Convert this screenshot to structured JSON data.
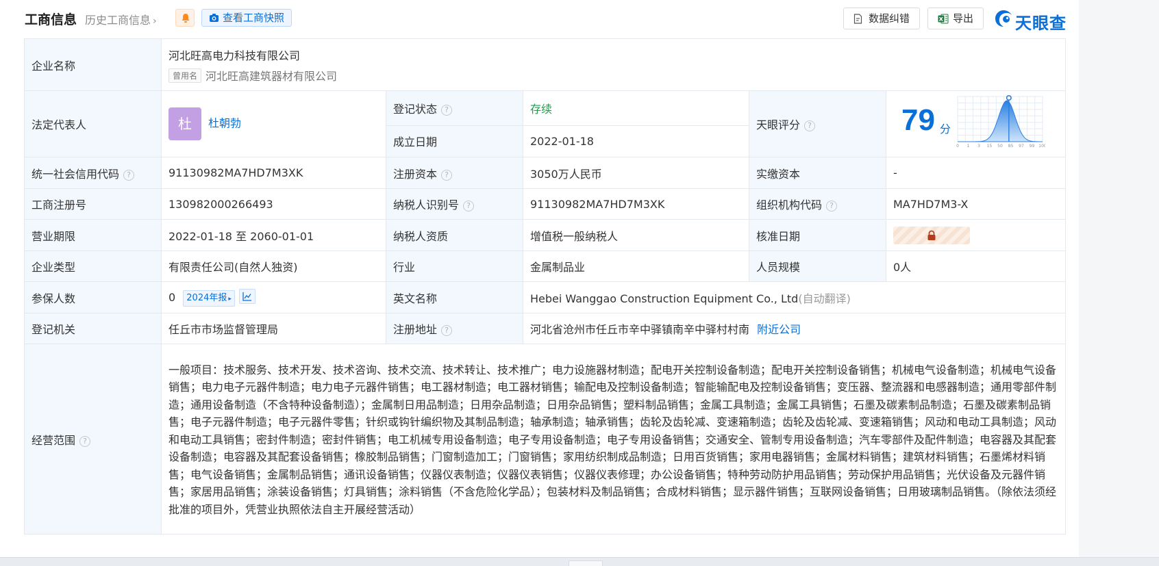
{
  "header": {
    "title": "工商信息",
    "history_link": "历史工商信息",
    "snapshot_button": "查看工商快照",
    "correct_button": "数据纠错",
    "export_button": "导出",
    "logo_text": "天眼查",
    "colors": {
      "accent": "#0a6fd6",
      "bell": "#ff8a1f",
      "excel": "#1f7a3f"
    }
  },
  "company": {
    "name_label": "企业名称",
    "name": "河北旺高电力科技有限公司",
    "used_name_tag": "曾用名",
    "used_name": "河北旺高建筑器材有限公司",
    "legal_rep_label": "法定代表人",
    "legal_rep_avatar": "杜",
    "legal_rep": "杜朝勃",
    "reg_status_label": "登记状态",
    "reg_status": "存续",
    "founded_label": "成立日期",
    "founded": "2022-01-18",
    "score_label": "天眼评分",
    "score": "79",
    "score_unit": "分",
    "credit_code_label": "统一社会信用代码",
    "credit_code": "91130982MA7HD7M3XK",
    "reg_capital_label": "注册资本",
    "reg_capital": "3050万人民币",
    "paid_capital_label": "实缴资本",
    "paid_capital": "-",
    "biz_reg_no_label": "工商注册号",
    "biz_reg_no": "130982000266493",
    "taxpayer_id_label": "纳税人识别号",
    "taxpayer_id": "91130982MA7HD7M3XK",
    "org_code_label": "组织机构代码",
    "org_code": "MA7HD7M3-X",
    "term_label": "营业期限",
    "term": "2022-01-18 至 2060-01-01",
    "taxpayer_qual_label": "纳税人资质",
    "taxpayer_qual": "增值税一般纳税人",
    "approve_date_label": "核准日期",
    "type_label": "企业类型",
    "type": "有限责任公司(自然人独资)",
    "industry_label": "行业",
    "industry": "金属制品业",
    "staff_label": "人员规模",
    "staff": "0人",
    "insured_label": "参保人数",
    "insured": "0",
    "insured_report": "2024年报",
    "en_name_label": "英文名称",
    "en_name": "Hebei Wanggao Construction Equipment Co., Ltd",
    "en_name_note": "(自动翻译)",
    "authority_label": "登记机关",
    "authority": "任丘市市场监督管理局",
    "address_label": "注册地址",
    "address": "河北省沧州市任丘市辛中驿镇南辛中驿村村南",
    "nearby_link": "附近公司",
    "scope_label": "经营范围",
    "scope": "一般项目：技术服务、技术开发、技术咨询、技术交流、技术转让、技术推广；电力设施器材制造；配电开关控制设备制造；配电开关控制设备销售；机械电气设备制造；机械电气设备销售；电力电子元器件制造；电力电子元器件销售；电工器材制造；电工器材销售；输配电及控制设备制造；智能输配电及控制设备销售；变压器、整流器和电感器制造；通用零部件制造；通用设备制造（不含特种设备制造）；金属制日用品制造；日用杂品制造；日用杂品销售；塑料制品销售；金属工具制造；金属工具销售；石墨及碳素制品制造；石墨及碳素制品销售；电子元器件制造；电子元器件零售；针织或钩针编织物及其制品制造；轴承制造；轴承销售；齿轮及齿轮减、变速箱制造；齿轮及齿轮减、变速箱销售；风动和电动工具制造；风动和电动工具销售；密封件制造；密封件销售；电工机械专用设备制造；电子专用设备制造；电子专用设备销售；交通安全、管制专用设备制造；汽车零部件及配件制造；电容器及其配套设备制造；电容器及其配套设备销售；橡胶制品销售；门窗制造加工；门窗销售；家用纺织制成品制造；日用百货销售；家用电器销售；金属材料销售；建筑材料销售；石墨烯材料销售；电气设备销售；金属制品销售；通讯设备销售；仪器仪表制造；仪器仪表销售；仪器仪表修理；办公设备销售；特种劳动防护用品销售；劳动保护用品销售；光伏设备及元器件销售；家居用品销售；涂装设备销售；灯具销售；涂料销售（不含危险化学品）；包装材料及制品销售；合成材料销售；显示器件销售；互联网设备销售；日用玻璃制品销售。（除依法须经批准的项目外，凭营业执照依法自主开展经营活动）"
  },
  "score_chart": {
    "ticks": [
      "0",
      "1",
      "3",
      "15",
      "50",
      "85",
      "97",
      "99",
      "100"
    ],
    "marker": 79
  },
  "icons": [
    "bell-icon",
    "camera-icon",
    "document-icon",
    "excel-icon",
    "eye-logo-icon",
    "help-icon",
    "lock-icon",
    "trend-icon"
  ]
}
